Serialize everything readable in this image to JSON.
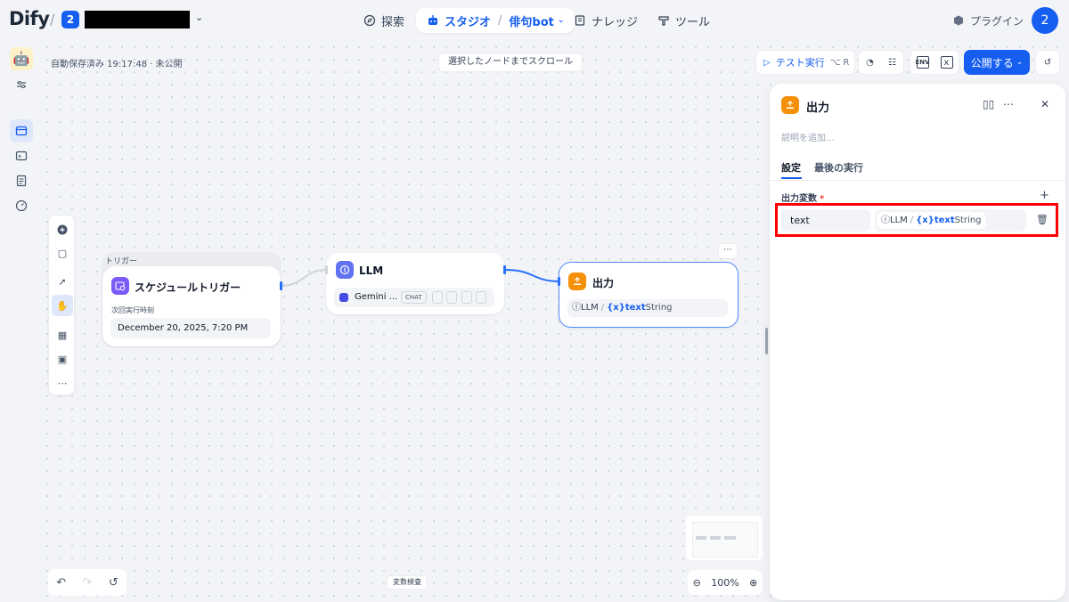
{
  "header": {
    "logo": "Dify",
    "workspace_badge": "2",
    "nav": {
      "explore": "探索",
      "studio": "スタジオ",
      "app_name": "俳句bot",
      "knowledge": "ナレッジ",
      "tools": "ツール",
      "plugins": "プラグイン"
    },
    "avatar": "2"
  },
  "canvas": {
    "autosave": "自動保存済み 19:17:48 · 未公開",
    "scroll_to_node": "選択したノードまでスクロール",
    "test_run": "テスト実行",
    "test_run_kbd": "⌥ R",
    "publish": "公開する",
    "var_inspect": "変数検査",
    "zoom": "100%"
  },
  "nodes": {
    "trigger": {
      "group_label": "トリガー",
      "title": "スケジュールトリガー",
      "next_run_label": "次回実行時刻",
      "next_run_value": "December 20, 2025, 7:20 PM"
    },
    "llm": {
      "title": "LLM",
      "model": "Gemini ...",
      "mode": "CHAT"
    },
    "output": {
      "title": "出力",
      "var_source": "LLM",
      "var_sep": "/",
      "var_name": "text",
      "var_type": "String"
    }
  },
  "panel": {
    "title": "出力",
    "description_placeholder": "説明を追加...",
    "tabs": [
      "設定",
      "最後の実行"
    ],
    "section_label": "出力変数",
    "required_mark": "*",
    "add": "+",
    "variable": {
      "name": "text",
      "source": "LLM",
      "sep": "/",
      "ref_name": "text",
      "type": "String"
    }
  },
  "colors": {
    "accent": "#155eef",
    "output_icon": "#f79009",
    "trigger_icon": "#7a5af8",
    "llm_icon": "#6172f3",
    "highlight": "#ff0000"
  }
}
